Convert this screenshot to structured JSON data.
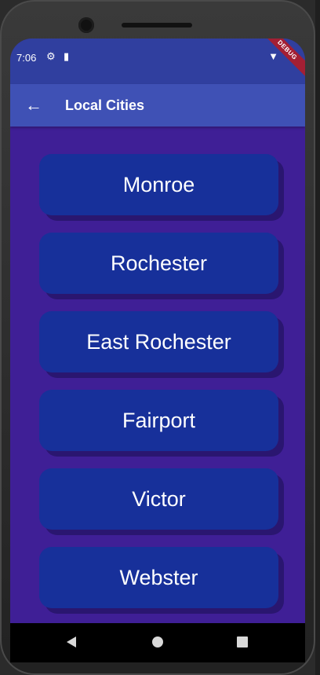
{
  "status_bar": {
    "time": "7:06",
    "icons": [
      "gear-icon",
      "sd-card-icon",
      "wifi-icon",
      "battery-icon"
    ],
    "debug_label": "DEBUG"
  },
  "app_bar": {
    "title": "Local Cities",
    "back_icon": "arrow-left-icon"
  },
  "cities": [
    {
      "label": "Monroe"
    },
    {
      "label": "Rochester"
    },
    {
      "label": "East Rochester"
    },
    {
      "label": "Fairport"
    },
    {
      "label": "Victor"
    },
    {
      "label": "Webster"
    }
  ],
  "colors": {
    "status_bar_bg": "#303f9f",
    "app_bar_bg": "#3f51b5",
    "body_bg": "#3f1f96",
    "button_bg": "#17309a",
    "button_shadow": "#2a1670"
  }
}
